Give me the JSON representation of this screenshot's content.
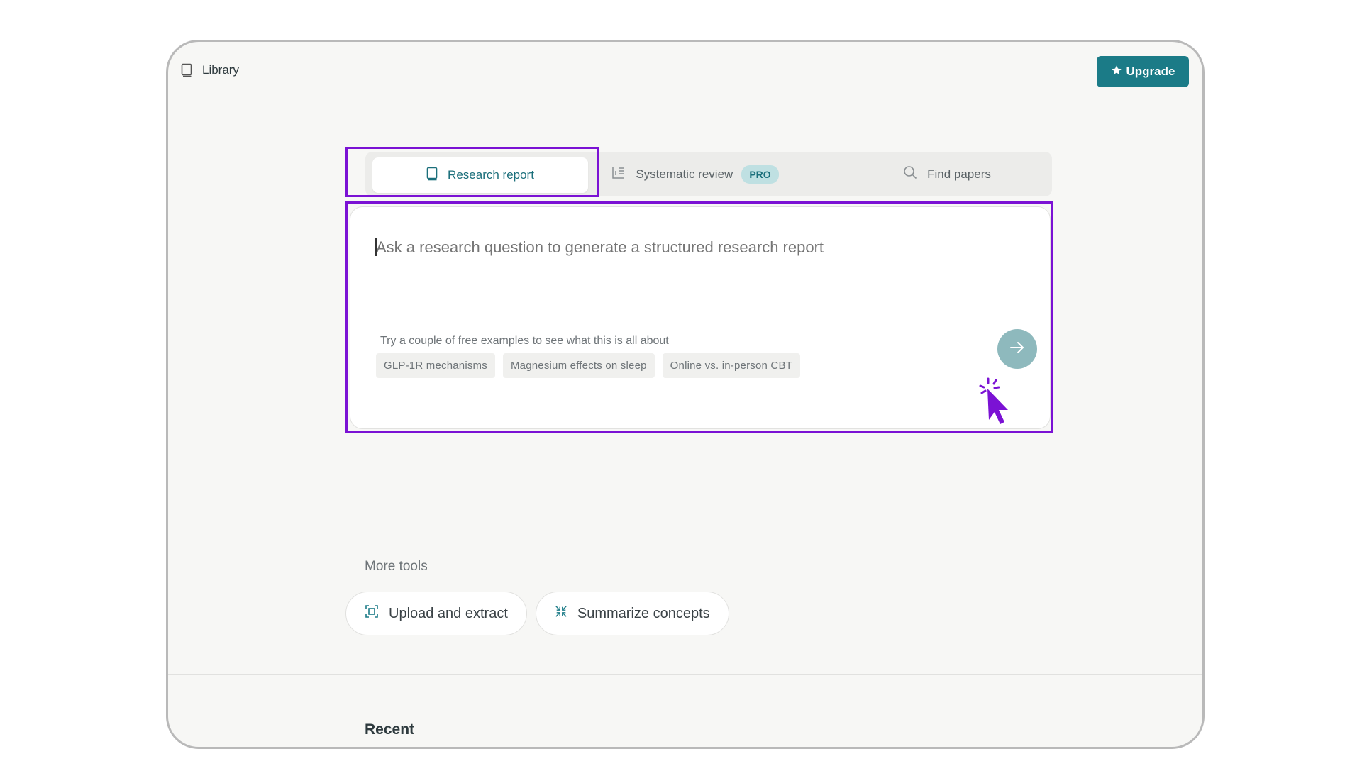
{
  "header": {
    "library_label": "Library",
    "upgrade_label": "Upgrade"
  },
  "tabs": [
    {
      "label": "Research report",
      "icon": "book-icon",
      "active": true
    },
    {
      "label": "Systematic review",
      "icon": "list-chart-icon",
      "badge": "PRO"
    },
    {
      "label": "Find papers",
      "icon": "search-icon"
    }
  ],
  "query": {
    "placeholder": "Ask a research question to generate a structured research report",
    "examples_hint": "Try a couple of free examples to see what this is all about",
    "examples": [
      "GLP-1R mechanisms",
      "Magnesium effects on sleep",
      "Online vs. in-person CBT"
    ]
  },
  "more_tools": {
    "heading": "More tools",
    "items": [
      {
        "label": "Upload and extract",
        "icon": "scan-icon"
      },
      {
        "label": "Summarize concepts",
        "icon": "compress-icon"
      }
    ]
  },
  "recent": {
    "heading": "Recent"
  },
  "colors": {
    "accent": "#1b7b87",
    "highlight": "#7b12d4",
    "send_button": "#8eb9bd"
  }
}
